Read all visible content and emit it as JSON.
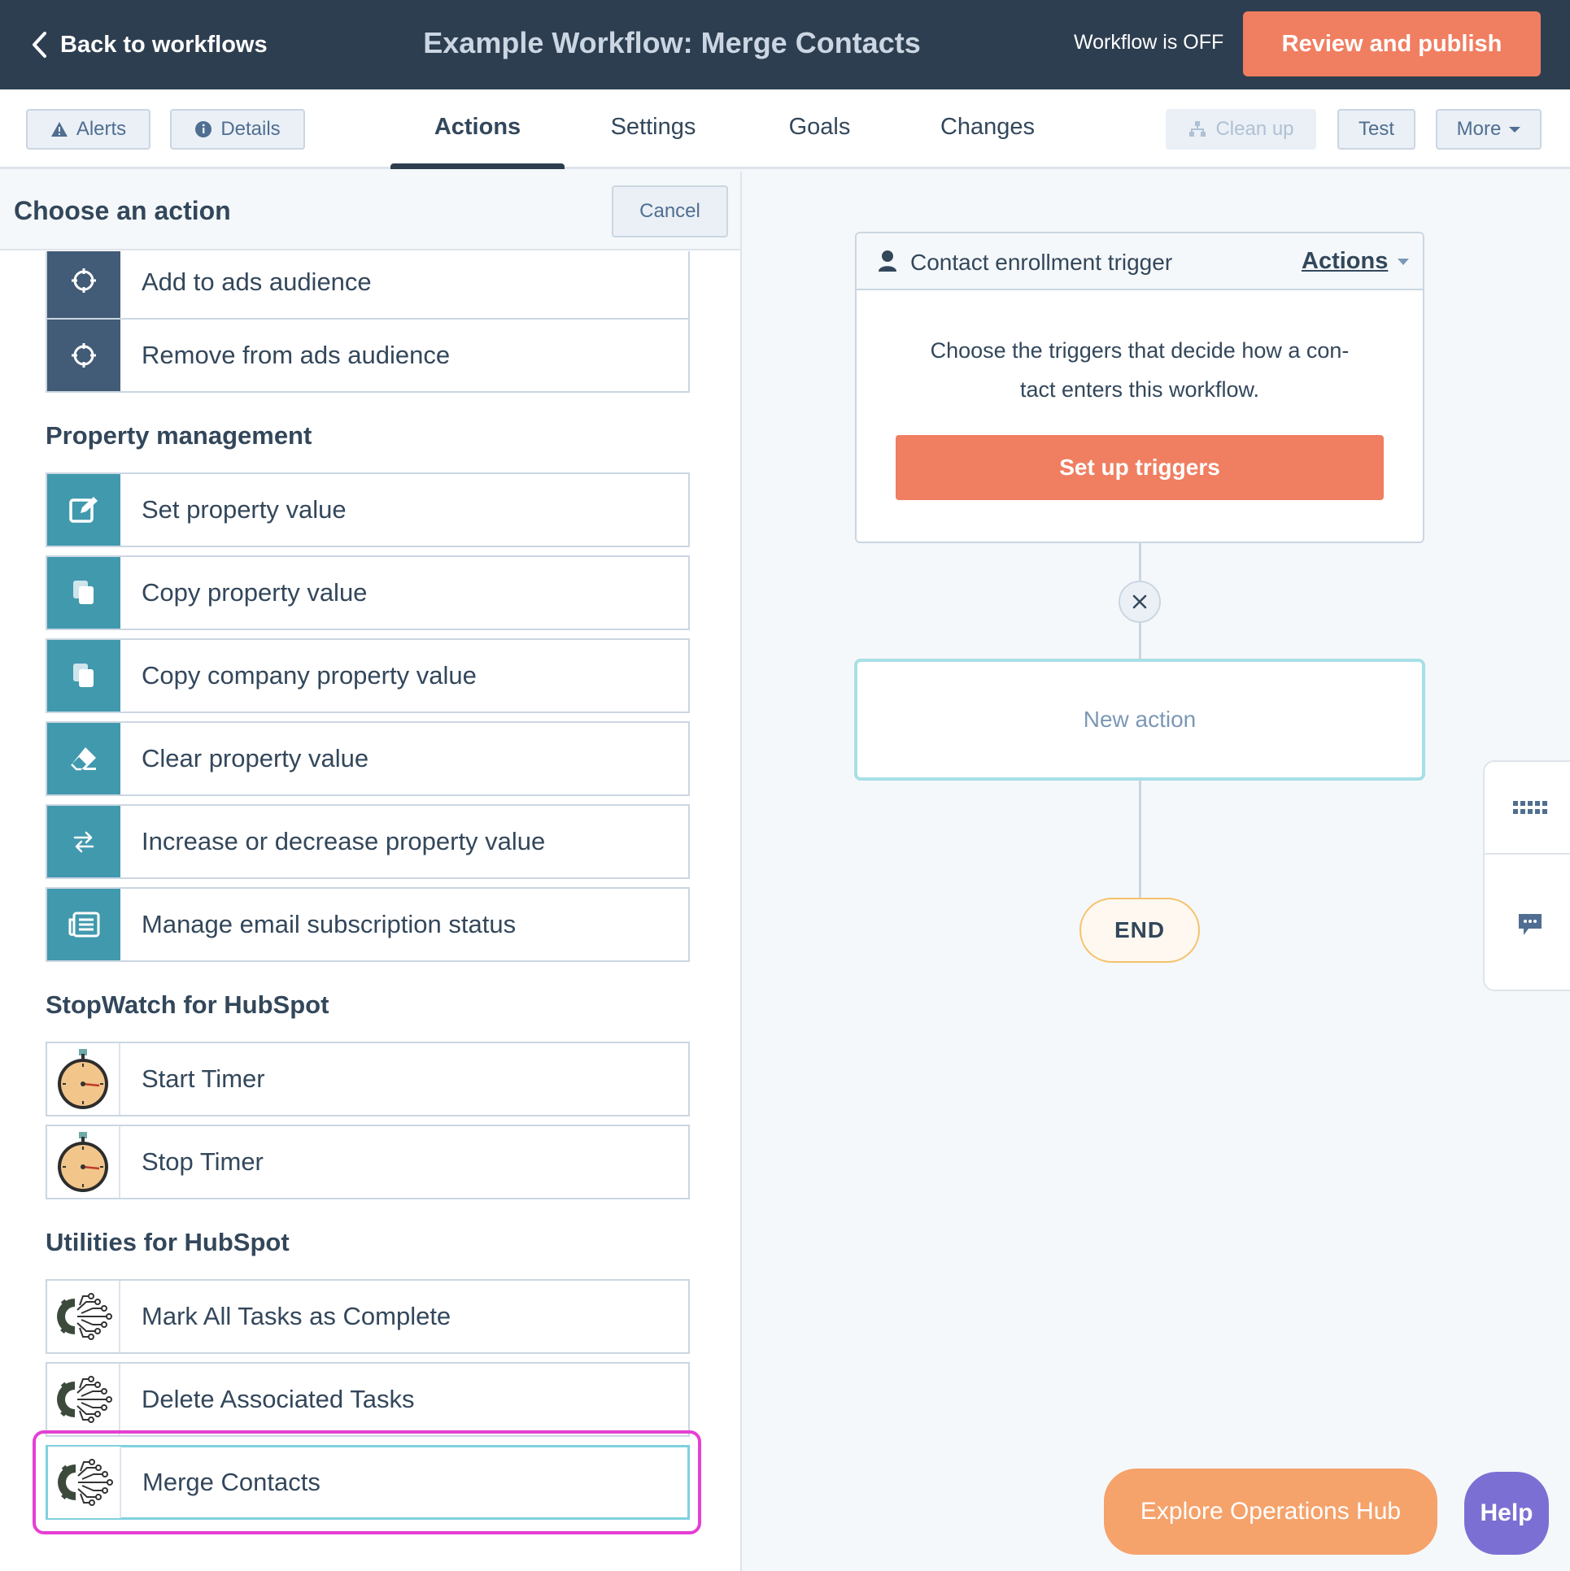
{
  "topbar": {
    "back_label": "Back to workflows",
    "title": "Example Workflow: Merge Contacts",
    "status": "Workflow is OFF",
    "publish_label": "Review and publish"
  },
  "subnav": {
    "alerts": "Alerts",
    "details": "Details",
    "tabs": [
      "Actions",
      "Settings",
      "Goals",
      "Changes"
    ],
    "active_tab": "Actions",
    "cleanup": "Clean up",
    "test": "Test",
    "more": "More"
  },
  "panel": {
    "title": "Choose an action",
    "cancel": "Cancel",
    "ads_items": [
      "Add to ads audience",
      "Remove from ads audience"
    ],
    "property_section": "Property management",
    "property_items": [
      "Set property value",
      "Copy property value",
      "Copy company property value",
      "Clear property value",
      "Increase or decrease property value",
      "Manage email subscription status"
    ],
    "stopwatch_section": "StopWatch for HubSpot",
    "stopwatch_items": [
      "Start Timer",
      "Stop Timer"
    ],
    "utilities_section": "Utilities for HubSpot",
    "utilities_items": [
      "Mark All Tasks as Complete",
      "Delete Associated Tasks",
      "Merge Contacts"
    ]
  },
  "canvas": {
    "trigger_title": "Contact enrollment trigger",
    "trigger_actions": "Actions",
    "trigger_desc_line1": "Choose the triggers that decide how a con-",
    "trigger_desc_line2": "tact enters this workflow.",
    "setup_label": "Set up triggers",
    "new_action": "New action",
    "end_label": "END"
  },
  "footer": {
    "explore": "Explore Operations Hub",
    "help": "Help"
  },
  "colors": {
    "topbar": "#2d3e50",
    "accent_orange": "#f07e61",
    "teal_icon": "#4199ae",
    "dark_icon": "#425b76",
    "highlight": "#e53fd4"
  }
}
